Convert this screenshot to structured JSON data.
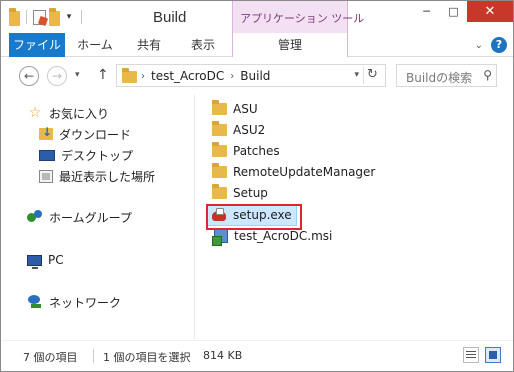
{
  "window": {
    "title": "Build",
    "context_tab_header": "アプリケーション ツール",
    "controls": {
      "minimize": "─",
      "maximize": "□",
      "close": "✕"
    }
  },
  "ribbon": {
    "tabs": [
      {
        "label": "ファイル"
      },
      {
        "label": "ホーム"
      },
      {
        "label": "共有"
      },
      {
        "label": "表示"
      },
      {
        "label": "管理"
      }
    ],
    "help": "?"
  },
  "address": {
    "crumbs": [
      "test_AcroDC",
      "Build"
    ],
    "search_placeholder": "Buildの検索"
  },
  "navpane": {
    "favorites": "お気に入り",
    "downloads": "ダウンロード",
    "desktop": "デスクトップ",
    "recent": "最近表示した場所",
    "homegroup": "ホームグループ",
    "pc": "PC",
    "network": "ネットワーク"
  },
  "files": [
    {
      "name": "ASU",
      "type": "folder"
    },
    {
      "name": "ASU2",
      "type": "folder"
    },
    {
      "name": "Patches",
      "type": "folder"
    },
    {
      "name": "RemoteUpdateManager",
      "type": "folder"
    },
    {
      "name": "Setup",
      "type": "folder"
    },
    {
      "name": "setup.exe",
      "type": "exe"
    },
    {
      "name": "test_AcroDC.msi",
      "type": "msi"
    }
  ],
  "status": {
    "item_count": "7 個の項目",
    "selected": "1 個の項目を選択",
    "size": "814 KB"
  },
  "colors": {
    "file_tab": "#1979ca",
    "context_tab": "#f3e1f3",
    "selection": "#cce8ff",
    "highlight_box": "#e0262b"
  }
}
